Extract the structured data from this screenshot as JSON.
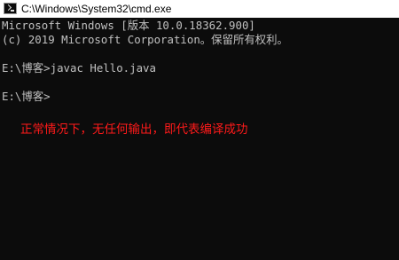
{
  "window": {
    "title": "C:\\Windows\\System32\\cmd.exe",
    "icon": "cmd-icon"
  },
  "console": {
    "lines": [
      "Microsoft Windows [版本 10.0.18362.900]",
      "(c) 2019 Microsoft Corporation。保留所有权利。",
      "E:\\博客>javac Hello.java",
      "E:\\博客>"
    ],
    "text_color": "#c0c0c0",
    "background_color": "#0c0c0c"
  },
  "annotation": {
    "text": "正常情况下，无任何输出，即代表编译成功",
    "color": "#ff1a1a"
  }
}
